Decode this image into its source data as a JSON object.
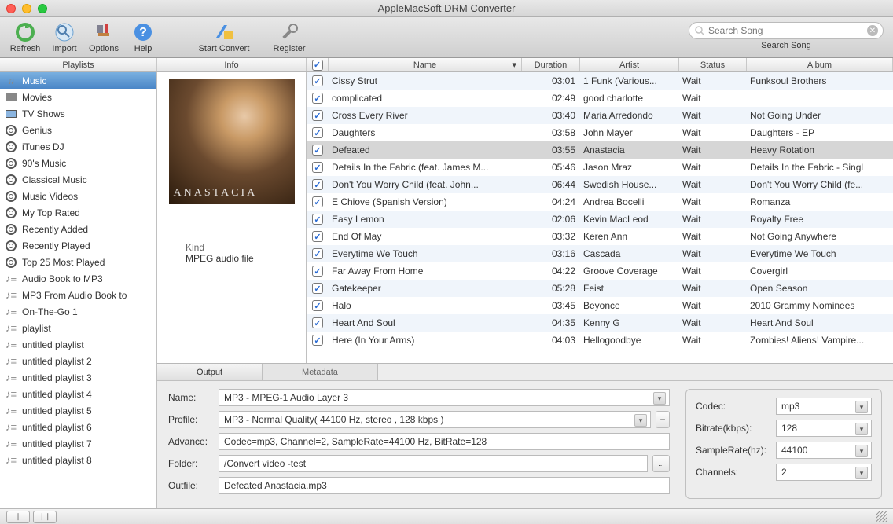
{
  "window": {
    "title": "AppleMacSoft DRM Converter"
  },
  "toolbar": {
    "refresh": "Refresh",
    "import": "Import",
    "options": "Options",
    "help": "Help",
    "start_convert": "Start Convert",
    "register": "Register",
    "search_placeholder": "Search Song",
    "search_caption": "Search Song"
  },
  "section_headers": {
    "playlists": "Playlists",
    "info": "Info"
  },
  "table_headers": {
    "name": "Name",
    "duration": "Duration",
    "artist": "Artist",
    "status": "Status",
    "album": "Album"
  },
  "sidebar": {
    "items": [
      {
        "label": "Music",
        "icon": "music",
        "selected": true
      },
      {
        "label": "Movies",
        "icon": "movie"
      },
      {
        "label": "TV Shows",
        "icon": "tv"
      },
      {
        "label": "Genius",
        "icon": "gear"
      },
      {
        "label": "iTunes DJ",
        "icon": "gear"
      },
      {
        "label": "90's Music",
        "icon": "gear"
      },
      {
        "label": "Classical Music",
        "icon": "gear"
      },
      {
        "label": "Music Videos",
        "icon": "gear"
      },
      {
        "label": "My Top Rated",
        "icon": "gear"
      },
      {
        "label": "Recently Added",
        "icon": "gear"
      },
      {
        "label": "Recently Played",
        "icon": "gear"
      },
      {
        "label": "Top 25 Most Played",
        "icon": "gear"
      },
      {
        "label": "Audio Book to MP3",
        "icon": "list"
      },
      {
        "label": "MP3 From Audio Book to",
        "icon": "list"
      },
      {
        "label": "On-The-Go 1",
        "icon": "list"
      },
      {
        "label": "playlist",
        "icon": "list"
      },
      {
        "label": "untitled playlist",
        "icon": "list"
      },
      {
        "label": "untitled playlist 2",
        "icon": "list"
      },
      {
        "label": "untitled playlist 3",
        "icon": "list"
      },
      {
        "label": "untitled playlist 4",
        "icon": "list"
      },
      {
        "label": "untitled playlist 5",
        "icon": "list"
      },
      {
        "label": "untitled playlist 6",
        "icon": "list"
      },
      {
        "label": "untitled playlist 7",
        "icon": "list"
      },
      {
        "label": "untitled playlist 8",
        "icon": "list"
      }
    ]
  },
  "info": {
    "kind_label": "Kind",
    "kind_value": "MPEG audio file"
  },
  "tracks": [
    {
      "name": "Cissy Strut",
      "duration": "03:01",
      "artist": "1 Funk (Various...",
      "status": "Wait",
      "album": "Funksoul Brothers"
    },
    {
      "name": "complicated",
      "duration": "02:49",
      "artist": "good charlotte",
      "status": "Wait",
      "album": ""
    },
    {
      "name": "Cross Every River",
      "duration": "03:40",
      "artist": "Maria Arredondo",
      "status": "Wait",
      "album": "Not Going Under"
    },
    {
      "name": "Daughters",
      "duration": "03:58",
      "artist": "John Mayer",
      "status": "Wait",
      "album": "Daughters - EP"
    },
    {
      "name": "Defeated",
      "duration": "03:55",
      "artist": "Anastacia",
      "status": "Wait",
      "album": "Heavy Rotation",
      "selected": true
    },
    {
      "name": "Details In the Fabric (feat. James M...",
      "duration": "05:46",
      "artist": "Jason Mraz",
      "status": "Wait",
      "album": "Details In the Fabric - Singl"
    },
    {
      "name": "Don't You Worry Child (feat. John...",
      "duration": "06:44",
      "artist": "Swedish House...",
      "status": "Wait",
      "album": "Don't You Worry Child (fe..."
    },
    {
      "name": "E Chiove (Spanish Version)",
      "duration": "04:24",
      "artist": "Andrea Bocelli",
      "status": "Wait",
      "album": "Romanza"
    },
    {
      "name": "Easy Lemon",
      "duration": "02:06",
      "artist": "Kevin MacLeod",
      "status": "Wait",
      "album": "Royalty Free"
    },
    {
      "name": "End Of May",
      "duration": "03:32",
      "artist": "Keren Ann",
      "status": "Wait",
      "album": "Not Going Anywhere"
    },
    {
      "name": "Everytime We Touch",
      "duration": "03:16",
      "artist": "Cascada",
      "status": "Wait",
      "album": "Everytime We Touch"
    },
    {
      "name": "Far Away From Home",
      "duration": "04:22",
      "artist": "Groove Coverage",
      "status": "Wait",
      "album": "Covergirl"
    },
    {
      "name": "Gatekeeper",
      "duration": "05:28",
      "artist": "Feist",
      "status": "Wait",
      "album": "Open Season"
    },
    {
      "name": "Halo",
      "duration": "03:45",
      "artist": "Beyonce",
      "status": "Wait",
      "album": "2010 Grammy Nominees"
    },
    {
      "name": "Heart And Soul",
      "duration": "04:35",
      "artist": "Kenny G",
      "status": "Wait",
      "album": "Heart And Soul"
    },
    {
      "name": "Here (In Your Arms)",
      "duration": "04:03",
      "artist": "Hellogoodbye",
      "status": "Wait",
      "album": "Zombies! Aliens! Vampire..."
    }
  ],
  "bottom": {
    "tabs": {
      "output": "Output",
      "metadata": "Metadata"
    },
    "labels": {
      "name": "Name:",
      "profile": "Profile:",
      "advance": "Advance:",
      "folder": "Folder:",
      "outfile": "Outfile:",
      "codec": "Codec:",
      "bitrate": "Bitrate(kbps):",
      "samplerate": "SampleRate(hz):",
      "channels": "Channels:"
    },
    "name": "MP3 - MPEG-1 Audio Layer 3",
    "profile": "MP3 - Normal Quality( 44100 Hz, stereo , 128 kbps )",
    "advance": "Codec=mp3, Channel=2, SampleRate=44100 Hz, BitRate=128",
    "folder": "/Convert video -test",
    "outfile": "Defeated Anastacia.mp3",
    "codec": "mp3",
    "bitrate": "128",
    "samplerate": "44100",
    "channels": "2"
  }
}
